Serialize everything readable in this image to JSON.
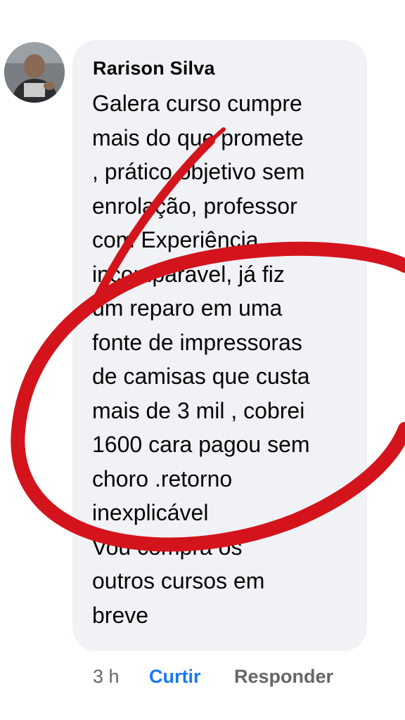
{
  "comment": {
    "author": "Rarison Silva",
    "text": "Galera curso cumpre\nmais do que promete\n, prático objetivo sem\nenrolação, professor\ncom Experiência\nincomparável, já fiz\num reparo em uma\nfonte de impressoras\nde camisas que custa\nmais de 3 mil , cobrei\n1600 cara pagou sem\nchoro .retorno\ninexplicável\nVou compra os\noutros cursos em\nbreve",
    "timestamp": "3 h",
    "like_label": "Curtir",
    "reply_label": "Responder"
  },
  "colors": {
    "bubble": "#f0f2f5",
    "text": "#050505",
    "secondary": "#65676b",
    "like": "#1877f2",
    "annotation": "#d3141c"
  },
  "annotation": {
    "type": "hand-drawn-circle"
  }
}
